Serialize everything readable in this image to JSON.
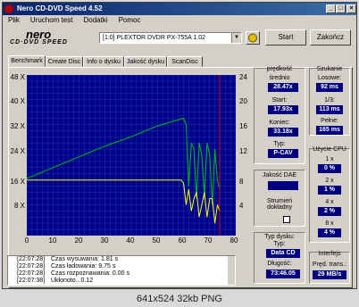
{
  "window": {
    "title": "Nero CD-DVD Speed 4.52"
  },
  "titlebar_buttons": {
    "minimize": "_",
    "maximize": "□",
    "close": "×"
  },
  "menu": [
    "Plik",
    "Uruchom test",
    "Dodatki",
    "Pomoc"
  ],
  "logo": {
    "top": "nero",
    "bottom": "CD·DVD SPEED"
  },
  "drive": {
    "selected": "[1:0]  PLEXTOR DVDR   PX-755A 1.02"
  },
  "buttons": {
    "start": "Start",
    "close": "Zakończ"
  },
  "tabs": [
    "Benchmark",
    "Create Disc",
    "Info o dysku",
    "Jakość dysku",
    "ScanDisc"
  ],
  "chart_data": {
    "type": "line",
    "y_left_ticks": [
      "48 X",
      "40 X",
      "32 X",
      "24 X",
      "16 X",
      "8 X"
    ],
    "y_right_ticks": [
      "24",
      "20",
      "16",
      "12",
      "8",
      "4"
    ],
    "x_ticks": [
      "0",
      "10",
      "20",
      "30",
      "40",
      "50",
      "60",
      "70",
      "80"
    ],
    "xlim": [
      0,
      80
    ],
    "ylim_left": [
      0,
      52
    ],
    "ylim_right": [
      0,
      26
    ],
    "grid": true,
    "marker_x": 73.8,
    "series": [
      {
        "color": "#00c000",
        "x": [
          0,
          10,
          20,
          30,
          40,
          50,
          60,
          61,
          62,
          63,
          64,
          65,
          66,
          67,
          68,
          69,
          70,
          71,
          72,
          73,
          73.8
        ],
        "values": [
          18.5,
          22,
          25.5,
          29,
          32,
          35.5,
          38,
          36,
          16,
          30,
          28,
          12,
          30,
          26,
          12,
          30,
          26,
          10,
          28,
          18,
          15
        ]
      },
      {
        "color": "#ffff00",
        "x": [
          0,
          10,
          20,
          30,
          40,
          50,
          59,
          60,
          61,
          62,
          63,
          64,
          65,
          66,
          67,
          68,
          69,
          70,
          71,
          72,
          73,
          73.8
        ],
        "values": [
          18,
          18,
          18,
          18,
          18,
          18,
          18,
          17,
          10,
          15,
          8,
          12,
          14,
          6,
          10,
          14,
          6,
          12,
          12,
          4,
          10,
          8
        ]
      }
    ]
  },
  "stats": {
    "speed_header": "prędkość",
    "avg_label": "średnio",
    "avg_value": "28.47x",
    "start_label": "Start:",
    "start_value": "17.93x",
    "end_label": "Koniec:",
    "end_value": "33.18x",
    "type_label": "Typ:",
    "type_value": "P-CAV",
    "dae_label": "Jakość DAE",
    "dae_value": "",
    "accurate_label": "Strumień dokładny"
  },
  "seek": {
    "header": "Szukanie",
    "random_label": "Losowe:",
    "random_value": "92 ms",
    "third_label": "1/3:",
    "third_value": "113 ms",
    "full_label": "Pełne:",
    "full_value": "165 ms"
  },
  "cpu": {
    "header": "Użycie CPU",
    "rows": [
      {
        "label": "1 x",
        "value": "0 %"
      },
      {
        "label": "2 x",
        "value": "1 %"
      },
      {
        "label": "4 x",
        "value": "2 %"
      },
      {
        "label": "8 x",
        "value": "4 %"
      }
    ]
  },
  "disc": {
    "header": "Typ dysku:",
    "type_label": "Typ:",
    "type_value": "Data CD",
    "length_label": "Długość:",
    "length_value": "73:46.05"
  },
  "interface": {
    "header": "Interfejs",
    "burst_label": "Pręd. trans.:",
    "burst_value": "29 MB/s"
  },
  "log": [
    {
      "time": "[22:07:28]",
      "msg": "Czas wysuwania: 1.81 s"
    },
    {
      "time": "[22:07:28]",
      "msg": "Czas ładowania: 9.75 s"
    },
    {
      "time": "[22:07:28]",
      "msg": "Czas rozpoznawania: 0.00 s"
    },
    {
      "time": "[22:07:38]",
      "msg": "Ukłonoto...0.12"
    }
  ],
  "caption": "641x524  32kb  PNG"
}
